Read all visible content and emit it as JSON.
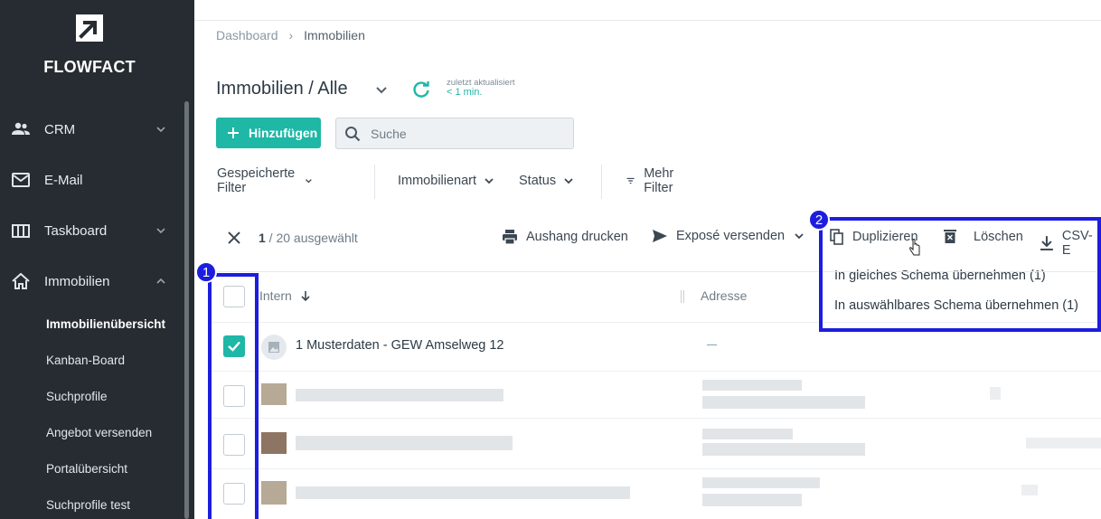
{
  "brand": {
    "name": "FLOWFACT"
  },
  "sidebar": {
    "items": [
      {
        "label": "CRM",
        "icon": "people-icon",
        "expandable": true,
        "expanded": false
      },
      {
        "label": "E-Mail",
        "icon": "mail-icon",
        "expandable": false
      },
      {
        "label": "Taskboard",
        "icon": "board-icon",
        "expandable": true,
        "expanded": false
      },
      {
        "label": "Immobilien",
        "icon": "home-icon",
        "expandable": true,
        "expanded": true
      }
    ],
    "subitems": [
      {
        "label": "Immobilienübersicht",
        "active": true
      },
      {
        "label": "Kanban-Board",
        "active": false
      },
      {
        "label": "Suchprofile",
        "active": false
      },
      {
        "label": "Angebot versenden",
        "active": false
      },
      {
        "label": "Portalübersicht",
        "active": false
      },
      {
        "label": "Suchprofile test",
        "active": false
      }
    ]
  },
  "breadcrumb": {
    "items": [
      "Dashboard",
      "Immobilien"
    ],
    "separator": "›"
  },
  "header": {
    "title": "Immobilien / Alle",
    "updated_label": "zuletzt aktualisiert",
    "updated_value": "< 1 min."
  },
  "toolbar": {
    "add_label": "Hinzufügen",
    "search_placeholder": "Suche"
  },
  "filters": {
    "saved": "Gespeicherte Filter",
    "type": "Immobilienart",
    "status": "Status",
    "more": "Mehr Filter"
  },
  "selection": {
    "count": "1",
    "total_text": " / 20 ausgewählt"
  },
  "actions": {
    "print": "Aushang drucken",
    "expose": "Exposé versenden",
    "duplicate": "Duplizieren",
    "delete": "Löschen",
    "csv": "CSV-E"
  },
  "duplicate_menu": {
    "options": [
      "In gleiches Schema übernehmen (1)",
      "In auswählbares Schema übernehmen (1)"
    ]
  },
  "annotations": {
    "badge1": "1",
    "badge2": "2"
  },
  "table": {
    "columns": [
      "Intern",
      "Adresse"
    ],
    "rows": [
      {
        "title": "1  Musterdaten - GEW Amselweg 12",
        "address": "—",
        "selected": true
      }
    ]
  },
  "colors": {
    "accent": "#1fb7a6",
    "sidebar_bg": "#262c31",
    "highlight": "#1d1dde"
  }
}
